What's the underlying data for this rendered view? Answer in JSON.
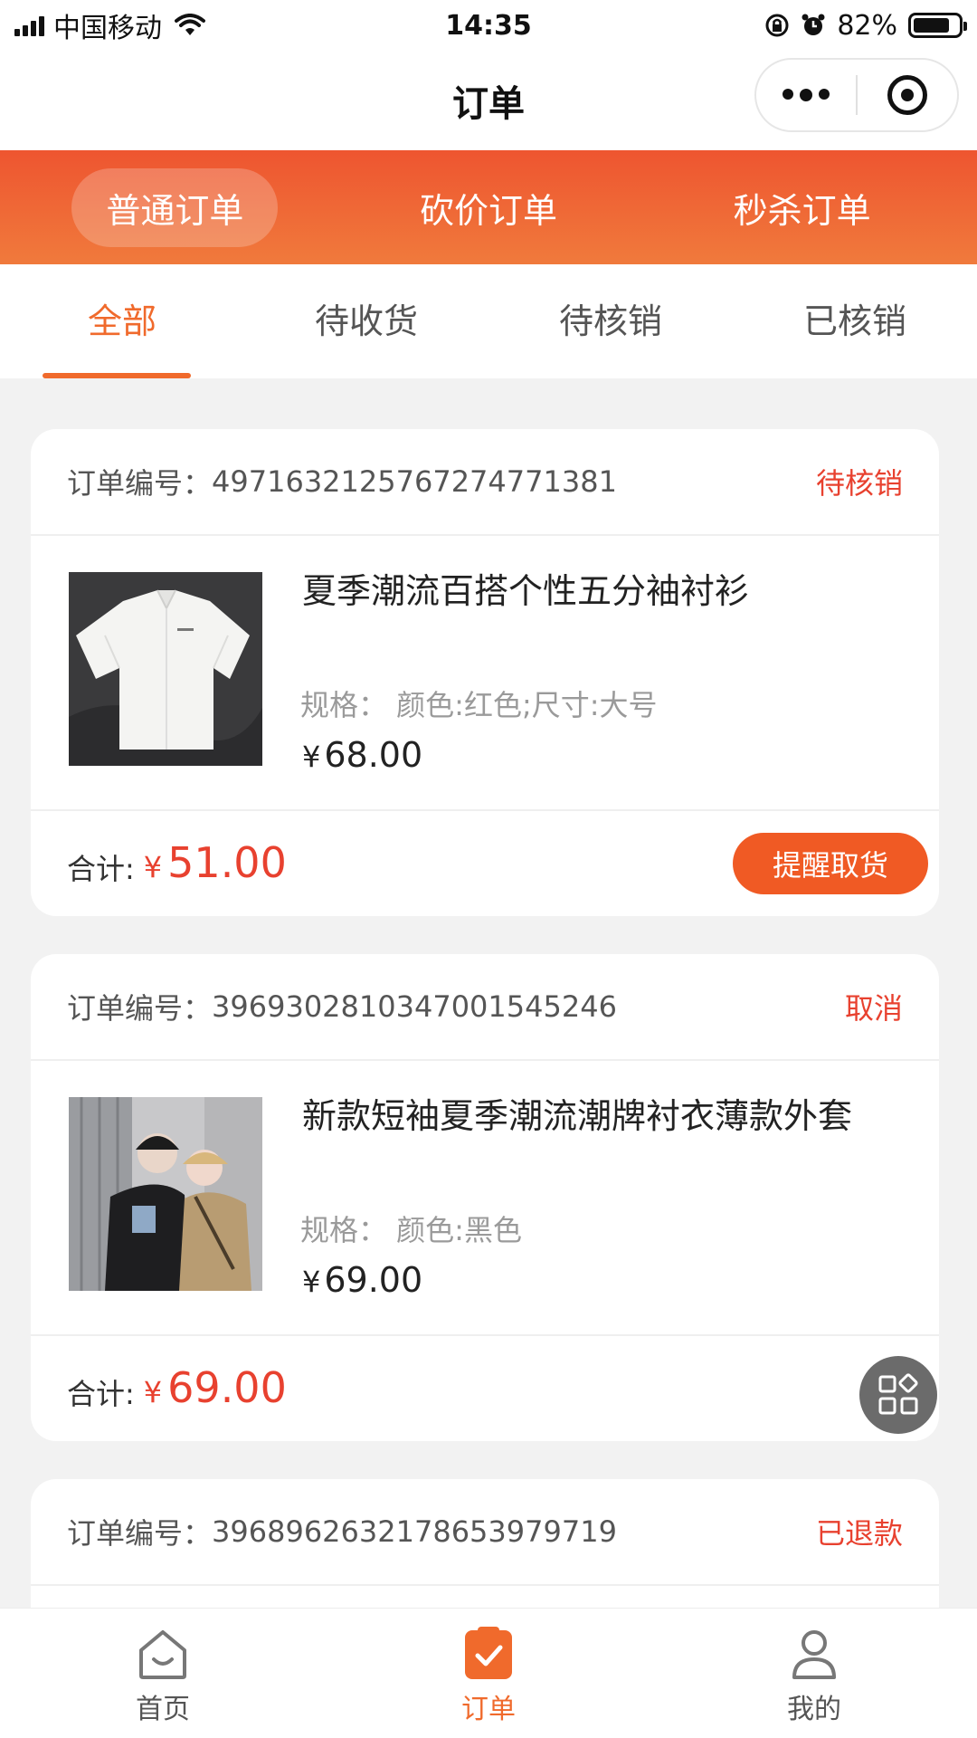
{
  "status_bar": {
    "carrier": "中国移动",
    "time": "14:35",
    "battery": "82%",
    "battery_level": 0.82
  },
  "nav": {
    "title": "订单"
  },
  "order_types": [
    {
      "label": "普通订单",
      "active": true
    },
    {
      "label": "砍价订单",
      "active": false
    },
    {
      "label": "秒杀订单",
      "active": false
    }
  ],
  "status_tabs": [
    {
      "label": "全部",
      "active": true
    },
    {
      "label": "待收货",
      "active": false
    },
    {
      "label": "待核销",
      "active": false
    },
    {
      "label": "已核销",
      "active": false
    }
  ],
  "orders": [
    {
      "no_label": "订单编号：",
      "no": "4971632125767274771381",
      "state": "待核销",
      "title": "夏季潮流百搭个性五分袖衬衫",
      "spec": "规格：  颜色:红色;尺寸:大号",
      "price_symbol": "¥",
      "price": "68.00",
      "total_label": "合计:",
      "total_symbol": "¥",
      "total": "51.00",
      "action": "提醒取货"
    },
    {
      "no_label": "订单编号：",
      "no": "3969302810347001545246",
      "state": "取消",
      "title": "新款短袖夏季潮流潮牌衬衣薄款外套",
      "spec": "规格：  颜色:黑色",
      "price_symbol": "¥",
      "price": "69.00",
      "total_label": "合计:",
      "total_symbol": "¥",
      "total": "69.00"
    },
    {
      "no_label": "订单编号：",
      "no": "3968962632178653979719",
      "state": "已退款"
    }
  ],
  "tabbar": [
    {
      "label": "首页",
      "icon": "home-icon",
      "active": false
    },
    {
      "label": "订单",
      "icon": "order-icon",
      "active": true
    },
    {
      "label": "我的",
      "icon": "profile-icon",
      "active": false
    }
  ],
  "colors": {
    "accent": "#f06a2c",
    "price_red": "#e8412f",
    "header_gradient_start": "#ee5530",
    "header_gradient_end": "#f07a3c"
  }
}
